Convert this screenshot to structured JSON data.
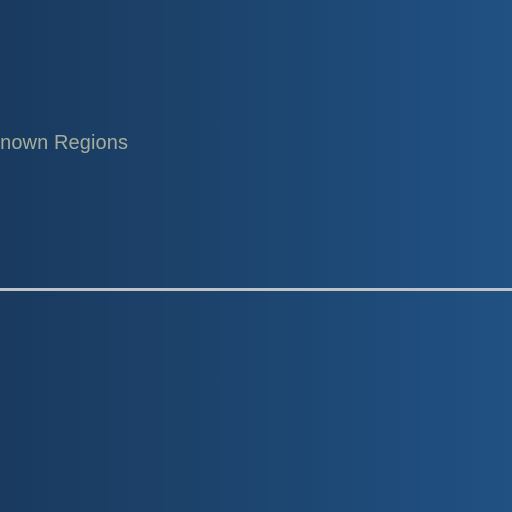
{
  "header": {
    "region_label": "known Regions"
  },
  "colors": {
    "background_left": "#1a3a5f",
    "background_right": "#205183",
    "label_text": "#a5ad9b",
    "divider": "#bfc2c6"
  }
}
